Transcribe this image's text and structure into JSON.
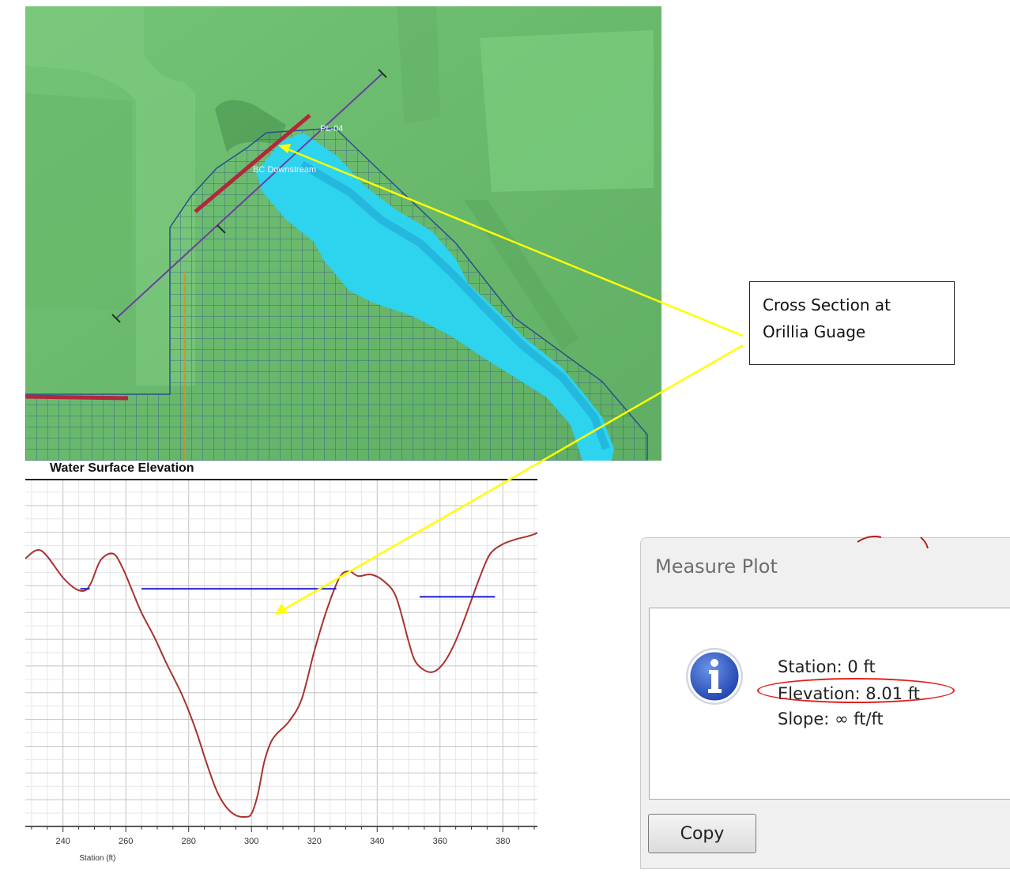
{
  "map": {
    "labels": {
      "profile_line": "PL-04",
      "bc_line": "BC Downstream"
    },
    "colors": {
      "terrain": "#6fbf72",
      "water": "#2ed3ee",
      "mesh": "#2c4f8c",
      "bc_line": "#b2283b",
      "profile_line": "#6a3fa0",
      "orange_line": "#e08a28"
    }
  },
  "callout": {
    "line1": "Cross Section at",
    "line2": "Orillia Guage",
    "arrow_color": "#ffff00"
  },
  "chart_data": {
    "type": "line",
    "title": "Water Surface Elevation",
    "xlabel": "Station (ft)",
    "ylabel": "",
    "xlim": [
      228,
      391
    ],
    "x_ticks": [
      240,
      260,
      280,
      300,
      320,
      340,
      360,
      380
    ],
    "grid": true,
    "series": [
      {
        "role": "terrain",
        "color": "#a83232",
        "x": [
          228,
          233,
          240,
          244,
          247,
          249,
          252,
          256,
          259,
          262,
          265,
          269,
          273,
          278,
          282,
          286,
          289,
          292,
          295,
          298,
          300,
          302,
          304,
          306,
          308,
          312,
          316,
          320,
          324,
          328,
          331,
          334,
          338,
          342,
          346,
          350,
          352,
          355,
          358,
          361,
          364,
          367,
          370,
          373,
          376,
          380,
          384,
          388,
          391
        ],
        "y": [
          8.9,
          9.15,
          8.3,
          7.95,
          7.9,
          8.15,
          8.85,
          9.05,
          8.6,
          7.9,
          7.2,
          6.45,
          5.6,
          4.6,
          3.6,
          2.4,
          1.6,
          1.1,
          0.85,
          0.8,
          0.9,
          1.5,
          2.5,
          3.1,
          3.4,
          3.8,
          4.5,
          6.0,
          7.3,
          8.3,
          8.5,
          8.35,
          8.4,
          8.2,
          7.7,
          6.3,
          5.7,
          5.4,
          5.35,
          5.6,
          6.1,
          6.8,
          7.6,
          8.4,
          9.05,
          9.35,
          9.5,
          9.6,
          9.7
        ]
      }
    ],
    "water_segments": [
      {
        "x": [
          245.5,
          248.5
        ],
        "y": 7.95
      },
      {
        "x": [
          265,
          327
        ],
        "y": 7.95
      },
      {
        "x": [
          353.5,
          377.5
        ],
        "y": 7.7
      }
    ],
    "water_color": "#1a1acc"
  },
  "dialog": {
    "title": "Measure Plot",
    "station": "Station: 0 ft",
    "elevation": "Elevation: 8.01 ft",
    "slope": "Slope: ∞ ft/ft",
    "copy_label": "Copy",
    "icon": "info-icon",
    "highlight_color": "#e02020"
  }
}
